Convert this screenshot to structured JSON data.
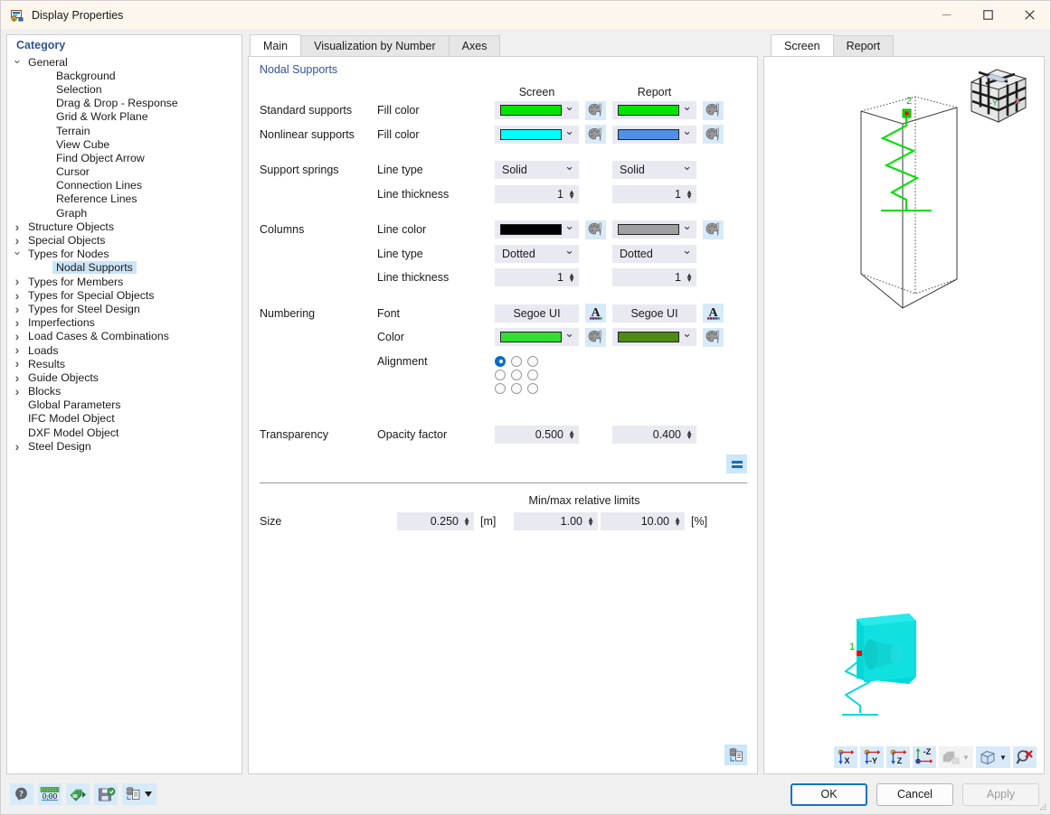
{
  "window": {
    "title": "Display Properties",
    "icon": "display-properties-icon",
    "minimize": "minimize-icon",
    "maximize": "maximize-icon",
    "close": "close-icon"
  },
  "tree": {
    "header": "Category",
    "items": [
      {
        "label": "General",
        "level": 1,
        "state": "open"
      },
      {
        "label": "Background",
        "level": 2,
        "state": "leaf"
      },
      {
        "label": "Selection",
        "level": 2,
        "state": "leaf"
      },
      {
        "label": "Drag & Drop - Response",
        "level": 2,
        "state": "leaf"
      },
      {
        "label": "Grid & Work Plane",
        "level": 2,
        "state": "leaf"
      },
      {
        "label": "Terrain",
        "level": 2,
        "state": "leaf"
      },
      {
        "label": "View Cube",
        "level": 2,
        "state": "leaf"
      },
      {
        "label": "Find Object Arrow",
        "level": 2,
        "state": "leaf"
      },
      {
        "label": "Cursor",
        "level": 2,
        "state": "leaf"
      },
      {
        "label": "Connection Lines",
        "level": 2,
        "state": "leaf"
      },
      {
        "label": "Reference Lines",
        "level": 2,
        "state": "leaf"
      },
      {
        "label": "Graph",
        "level": 2,
        "state": "leaf"
      },
      {
        "label": "Structure Objects",
        "level": 1,
        "state": "closed"
      },
      {
        "label": "Special Objects",
        "level": 1,
        "state": "closed"
      },
      {
        "label": "Types for Nodes",
        "level": 1,
        "state": "open"
      },
      {
        "label": "Nodal Supports",
        "level": 2,
        "state": "leaf",
        "selected": true
      },
      {
        "label": "Types for Members",
        "level": 1,
        "state": "closed"
      },
      {
        "label": "Types for Special Objects",
        "level": 1,
        "state": "closed"
      },
      {
        "label": "Types for Steel Design",
        "level": 1,
        "state": "closed"
      },
      {
        "label": "Imperfections",
        "level": 1,
        "state": "closed"
      },
      {
        "label": "Load Cases & Combinations",
        "level": 1,
        "state": "closed"
      },
      {
        "label": "Loads",
        "level": 1,
        "state": "closed"
      },
      {
        "label": "Results",
        "level": 1,
        "state": "closed"
      },
      {
        "label": "Guide Objects",
        "level": 1,
        "state": "closed"
      },
      {
        "label": "Blocks",
        "level": 1,
        "state": "closed"
      },
      {
        "label": "Global Parameters",
        "level": 1,
        "state": "leaf"
      },
      {
        "label": "IFC Model Object",
        "level": 1,
        "state": "leaf"
      },
      {
        "label": "DXF Model Object",
        "level": 1,
        "state": "leaf"
      },
      {
        "label": "Steel Design",
        "level": 1,
        "state": "closed"
      }
    ]
  },
  "tabs": [
    {
      "label": "Main",
      "active": true
    },
    {
      "label": "Visualization by Number",
      "active": false
    },
    {
      "label": "Axes",
      "active": false
    }
  ],
  "main": {
    "group_title": "Nodal Supports",
    "column_headers": [
      "Screen",
      "Report"
    ],
    "rows": [
      {
        "group": "Standard supports",
        "property": "Fill color",
        "type": "color",
        "screen": {
          "color": "#00e500"
        },
        "report": {
          "color": "#00e500"
        },
        "palette_icon": "color-palette-icon"
      },
      {
        "group": "Nonlinear supports",
        "property": "Fill color",
        "type": "color",
        "screen": {
          "color": "#00ffff"
        },
        "report": {
          "color": "#5090e8"
        },
        "palette_icon": "color-palette-icon"
      },
      {
        "group": "Support springs",
        "property": "Line type",
        "type": "select",
        "screen": {
          "value": "Solid"
        },
        "report": {
          "value": "Solid"
        }
      },
      {
        "group": "",
        "property": "Line thickness",
        "type": "spin",
        "screen": {
          "value": "1"
        },
        "report": {
          "value": "1"
        }
      },
      {
        "group": "Columns",
        "property": "Line color",
        "type": "color",
        "screen": {
          "color": "#000000"
        },
        "report": {
          "color": "#a0a0a0"
        },
        "palette_icon": "color-palette-icon"
      },
      {
        "group": "",
        "property": "Line type",
        "type": "select",
        "screen": {
          "value": "Dotted"
        },
        "report": {
          "value": "Dotted"
        }
      },
      {
        "group": "",
        "property": "Line thickness",
        "type": "spin",
        "screen": {
          "value": "1"
        },
        "report": {
          "value": "1"
        }
      },
      {
        "group": "Numbering",
        "property": "Font",
        "type": "fontbtn",
        "screen": {
          "value": "Segoe UI"
        },
        "report": {
          "value": "Segoe UI"
        },
        "font_icon": "font-color-icon"
      },
      {
        "group": "",
        "property": "Color",
        "type": "color",
        "screen": {
          "color": "#33dd33"
        },
        "report": {
          "color": "#4f8a14"
        },
        "palette_icon": "color-palette-icon"
      },
      {
        "group": "",
        "property": "Alignment",
        "type": "radiogrid",
        "selected_index": 0
      },
      {
        "group": "Transparency",
        "property": "Opacity factor",
        "type": "spin",
        "screen": {
          "value": "0.500"
        },
        "report": {
          "value": "0.400"
        }
      }
    ],
    "equalize_button": "equalize-icon",
    "copy_button": "copy-to-clipboard-icon",
    "size_section": {
      "limits_label": "Min/max relative limits",
      "size_label": "Size",
      "size_value": "0.250",
      "size_unit": "[m]",
      "min_value": "1.00",
      "max_value": "10.00",
      "limits_unit": "[%]"
    }
  },
  "preview": {
    "tabs": [
      {
        "label": "Screen",
        "active": true
      },
      {
        "label": "Report",
        "active": false
      }
    ],
    "viewcube": {
      "label_y": "-Y",
      "label_x": "X"
    },
    "model_top": {
      "node_label": "2",
      "spring_color": "#00e000",
      "node_color": "#ff0000",
      "outline_color": "#404040"
    },
    "model_bottom": {
      "node_label": "1",
      "plate_color": "#00e4e4",
      "spring_color": "#00e4e4",
      "node_color": "#ff0000"
    },
    "toolbar": [
      {
        "name": "view-along-x-button",
        "label": "X",
        "enabled": true
      },
      {
        "name": "view-along-negative-y-button",
        "label": "-Y",
        "enabled": true
      },
      {
        "name": "view-along-z-button",
        "label": "Z",
        "enabled": true
      },
      {
        "name": "view-along-negative-z-button",
        "label": "-Z",
        "enabled": true
      },
      {
        "name": "render-mode-button",
        "label": "",
        "enabled": false
      },
      {
        "name": "display-mode-button",
        "label": "",
        "enabled": true
      },
      {
        "name": "reset-zoom-button",
        "label": "",
        "enabled": true
      }
    ]
  },
  "bottom_toolbar": [
    {
      "name": "help-button",
      "icon": "help-icon"
    },
    {
      "name": "units-button",
      "icon": "units-0.00-icon"
    },
    {
      "name": "import-settings-button",
      "icon": "import-icon"
    },
    {
      "name": "save-settings-button",
      "icon": "save-icon"
    },
    {
      "name": "configuration-manager-button",
      "icon": "configuration-list-icon"
    }
  ],
  "dialog_buttons": {
    "ok": "OK",
    "cancel": "Cancel",
    "apply": "Apply"
  }
}
